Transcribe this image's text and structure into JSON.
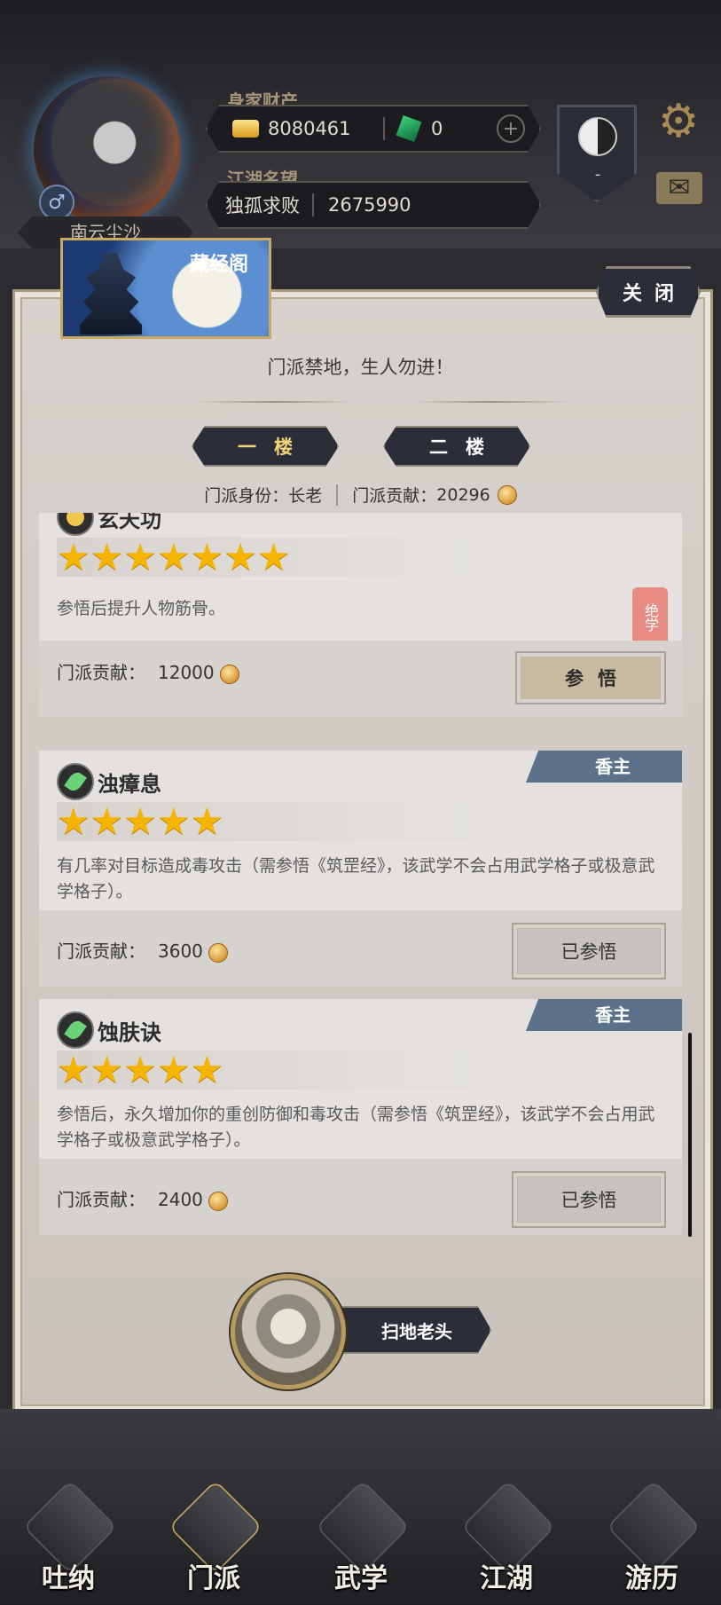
{
  "hud": {
    "player_name": "南云尘沙",
    "gender_symbol": "♂",
    "wealth_label": "身家财产",
    "gold": "8080461",
    "jade": "0",
    "plus": "+",
    "reputation_label": "江湖名望",
    "reputation_title": "独孤求败",
    "reputation_value": "2675990",
    "taiji_value": "-",
    "gear_glyph": "⚙",
    "mail_glyph": "✉"
  },
  "panel": {
    "banner_title": "藏经阁",
    "close_label": "关闭",
    "motto": "门派禁地，生人勿进！",
    "floors": [
      {
        "label": "一楼",
        "active": true
      },
      {
        "label": "二楼",
        "active": false
      }
    ],
    "identity_label": "门派身份：",
    "identity_value": "长老",
    "contribution_label": "门派贡献：",
    "contribution_value": "20296"
  },
  "skills": [
    {
      "name": "玄天功",
      "stars": 7,
      "star_glyphs": "★★★★★★★",
      "desc": "参悟后提升人物筋骨。",
      "cost_label": "门派贡献：",
      "cost": "12000",
      "button": "参悟",
      "seal": "绝学"
    },
    {
      "name": "浊瘴息",
      "tag": "香主",
      "stars": 5,
      "star_glyphs": "★★★★★",
      "desc": "有几率对目标造成毒攻击（需参悟《筑罡经》，该武学不会占用武学格子或极意武学格子）。",
      "cost_label": "门派贡献：",
      "cost": "3600",
      "button": "已参悟"
    },
    {
      "name": "蚀肤诀",
      "tag": "香主",
      "stars": 5,
      "star_glyphs": "★★★★★",
      "desc": "参悟后，永久增加你的重创防御和毒攻击（需参悟《筑罡经》，该武学不会占用武学格子或极意武学格子）。",
      "cost_label": "门派贡献：",
      "cost": "2400",
      "button": "已参悟"
    }
  ],
  "npc": {
    "name": "扫地老头"
  },
  "nav": [
    {
      "label": "吐纳",
      "icon": "gourd-icon"
    },
    {
      "label": "门派",
      "icon": "flag-icon",
      "active": true
    },
    {
      "label": "武学",
      "icon": "book-icon"
    },
    {
      "label": "江湖",
      "icon": "hat-icon"
    },
    {
      "label": "游历",
      "icon": "horse-icon"
    }
  ],
  "colors": {
    "tag_blue": "#5a7189",
    "star_gold": "#f4b400",
    "panel_bg": "#d7d2cd"
  }
}
